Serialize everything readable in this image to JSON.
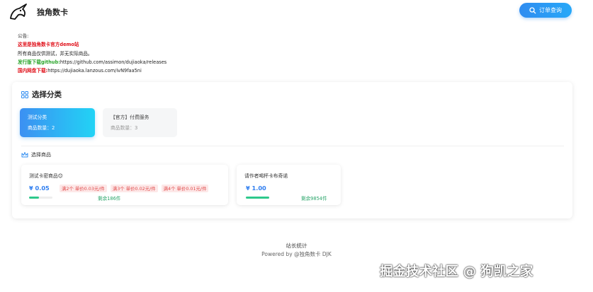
{
  "header": {
    "site_title": "独角数卡",
    "order_button": "订单查询"
  },
  "notice": {
    "title": "公告:",
    "line1": "这里是独角数卡官方demo站",
    "line2": "所有商品仅供测试，并无实际商品。",
    "line3_label": "发行版下载github:",
    "line3_url": "https://github.com/assimon/dujiaoka/releases",
    "line4_label": "国内网盘下载:",
    "line4_url": "https://dujiaoka.lanzous.com/ivN9faa5ni"
  },
  "categories_section": {
    "title": "选择分类",
    "items": [
      {
        "name": "测试分类",
        "count": "商品数量：2",
        "active": true
      },
      {
        "name": "【官方】付费服务",
        "count": "商品数量：3",
        "active": false
      }
    ]
  },
  "goods_section": {
    "title": "选择商品",
    "items": [
      {
        "name": "测试卡密商品😊",
        "price": "¥ 0.05",
        "tags": [
          "满2个 单价0.03元/件",
          "满3个 单价0.02元/件",
          "满4个 单价0.01元/件"
        ],
        "stock": "剩余186件",
        "stock_level": 0.42
      },
      {
        "name": "请作者喝杯卡布奇诺",
        "price": "¥ 1.00",
        "tags": [],
        "stock": "剩余9854件",
        "stock_level": 1.0
      }
    ]
  },
  "footer": {
    "title": "站长统计",
    "powered": "Powered by @独角数卡 DJK"
  },
  "watermark": "掘金技术社区 @ 狗凯之家",
  "colors": {
    "accent": "#2f8cf0",
    "notice_red": "#e0111a",
    "notice_green": "#2aa52a",
    "stock_green": "#2ec98c",
    "tag_red": "#e04848"
  },
  "icons": {
    "logo": "unicorn-logo",
    "order": "search-icon",
    "categories": "grid-icon",
    "goods": "crown-icon"
  }
}
